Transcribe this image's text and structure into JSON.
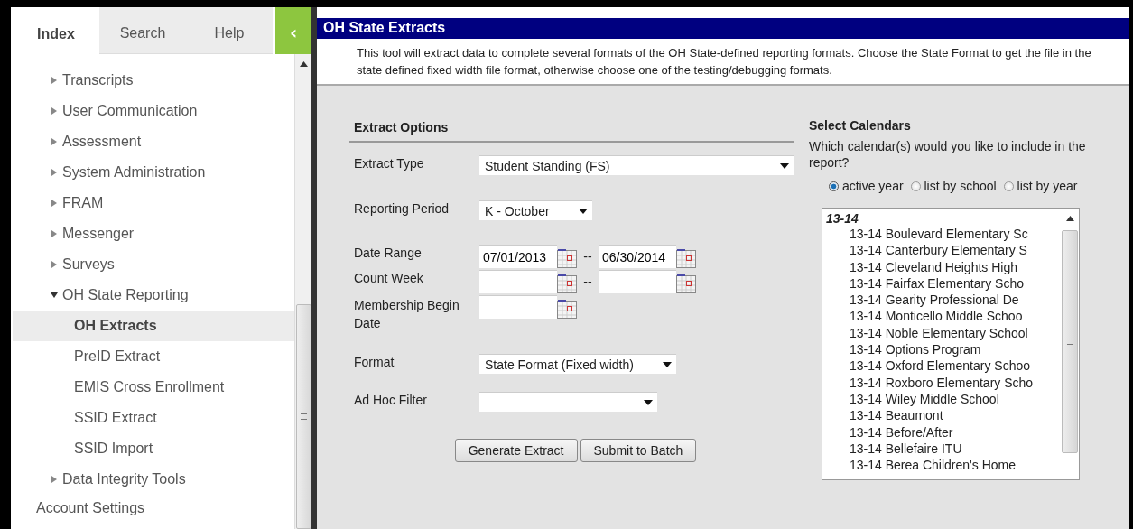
{
  "sidebar": {
    "tabs": [
      {
        "label": "Index",
        "selected": true
      },
      {
        "label": "Search",
        "selected": false
      },
      {
        "label": "Help",
        "selected": false
      }
    ],
    "collapse_button": "‹",
    "items": [
      {
        "label": "Transcripts",
        "expanded": false
      },
      {
        "label": "User Communication",
        "expanded": false
      },
      {
        "label": "Assessment",
        "expanded": false
      },
      {
        "label": "System Administration",
        "expanded": false
      },
      {
        "label": "FRAM",
        "expanded": false
      },
      {
        "label": "Messenger",
        "expanded": false
      },
      {
        "label": "Surveys",
        "expanded": false
      },
      {
        "label": "OH State Reporting",
        "expanded": true,
        "children": [
          {
            "label": "OH Extracts",
            "selected": true
          },
          {
            "label": "PreID Extract",
            "selected": false
          },
          {
            "label": "EMIS Cross Enrollment",
            "selected": false
          },
          {
            "label": "SSID Extract",
            "selected": false
          },
          {
            "label": "SSID Import",
            "selected": false
          }
        ]
      },
      {
        "label": "Data Integrity Tools",
        "expanded": false
      }
    ],
    "account_link": "Account Settings"
  },
  "main": {
    "title": "OH State Extracts",
    "description": "This tool will extract data to complete several formats of the OH State-defined reporting formats. Choose the State Format to get the file in the state defined fixed width file format, otherwise choose one of the testing/debugging formats.",
    "extract_options": {
      "heading": "Extract Options",
      "extract_type": {
        "label": "Extract Type",
        "value": "Student Standing (FS)"
      },
      "reporting_period": {
        "label": "Reporting Period",
        "value": "K - October"
      },
      "date_range": {
        "label": "Date Range",
        "start": "07/01/2013",
        "separator": "--",
        "end": "06/30/2014"
      },
      "count_week": {
        "label": "Count Week",
        "separator": "--"
      },
      "membership_begin_date": {
        "label": "Membership Begin Date"
      },
      "format": {
        "label": "Format",
        "value": "State Format (Fixed width)"
      },
      "ad_hoc_filter": {
        "label": "Ad Hoc Filter"
      },
      "buttons": [
        "Generate Extract",
        "Submit to Batch"
      ]
    },
    "select_calendars": {
      "heading": "Select Calendars",
      "question": "Which calendar(s) would you like to include in the report?",
      "options": [
        {
          "label": "active year",
          "selected": true
        },
        {
          "label": "list by school",
          "selected": false
        },
        {
          "label": "list by year",
          "selected": false
        }
      ],
      "group": "13-14",
      "calendars": [
        "13-14 Boulevard Elementary Sc",
        "13-14 Canterbury Elementary S",
        "13-14 Cleveland Heights High",
        "13-14 Fairfax Elementary Scho",
        "13-14 Gearity Professional De",
        "13-14 Monticello Middle Schoo",
        "13-14 Noble Elementary School",
        "13-14 Options Program",
        "13-14 Oxford Elementary Schoo",
        "13-14 Roxboro Elementary Scho",
        "13-14 Wiley Middle School",
        "13-14 Beaumont",
        "13-14 Before/After",
        "13-14 Bellefaire ITU",
        "13-14 Berea Children's Home"
      ]
    }
  }
}
